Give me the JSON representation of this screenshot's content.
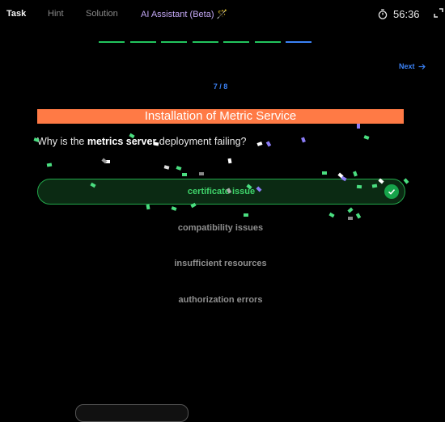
{
  "tabs": {
    "task": "Task",
    "hint": "Hint",
    "solution": "Solution",
    "ai_assistant": "AI Assistant (Beta)"
  },
  "timer": {
    "value": "56:36"
  },
  "progress": {
    "segments": [
      "done",
      "done",
      "done",
      "done",
      "done",
      "done",
      "current"
    ],
    "colors": {
      "done": "#22c55e",
      "current": "#3b82f6"
    }
  },
  "nav": {
    "next_label": "Next",
    "counter": "7 / 8"
  },
  "question": {
    "title": "Installation of Metric Service",
    "prefix": "Why is the ",
    "emphasis": "metrics server",
    "suffix": " deployment failing?"
  },
  "options": [
    {
      "label": "certificate issue",
      "state": "correct"
    },
    {
      "label": "compatibility issues",
      "state": "default"
    },
    {
      "label": "insufficient resources",
      "state": "default"
    },
    {
      "label": "authorization errors",
      "state": "default"
    }
  ],
  "colors": {
    "accent_orange": "#ff7a45",
    "correct_green": "#22c55e",
    "link_blue": "#3b82f6",
    "ai_purple": "#c4a8f6"
  }
}
